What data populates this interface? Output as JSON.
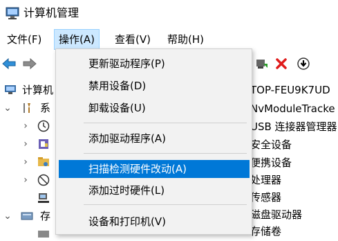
{
  "window": {
    "title": "计算机管理"
  },
  "menubar": [
    {
      "label": "文件(F)"
    },
    {
      "label": "操作(A)"
    },
    {
      "label": "查看(V)"
    },
    {
      "label": "帮助(H)"
    }
  ],
  "tree": {
    "root_label": "计算机",
    "system_tools_label": "系",
    "storage_label": "存"
  },
  "right_panel": [
    "TOP-FEU9K7UD",
    "NvModuleTracke",
    "USB 连接器管理器",
    "安全设备",
    "便携设备",
    "处理器",
    "传感器",
    "磁盘驱动器",
    "存储卷"
  ],
  "context_menu": {
    "items": [
      {
        "label": "更新驱动程序(P)"
      },
      {
        "label": "禁用设备(D)"
      },
      {
        "label": "卸载设备(U)"
      },
      {
        "label": "添加驱动程序(A)"
      },
      {
        "label": "扫描检测硬件改动(A)"
      },
      {
        "label": "添加过时硬件(L)"
      },
      {
        "label": "设备和打印机(V)"
      }
    ],
    "highlighted_index": 4
  },
  "icons": {
    "back": "arrow-left-icon",
    "forward": "arrow-right-icon",
    "enable": "enable-device-icon",
    "uninstall": "red-x-icon",
    "update": "down-arrow-circle-icon"
  },
  "colors": {
    "highlight": "#0078d7",
    "menu_active_bg": "#cce8ff"
  }
}
